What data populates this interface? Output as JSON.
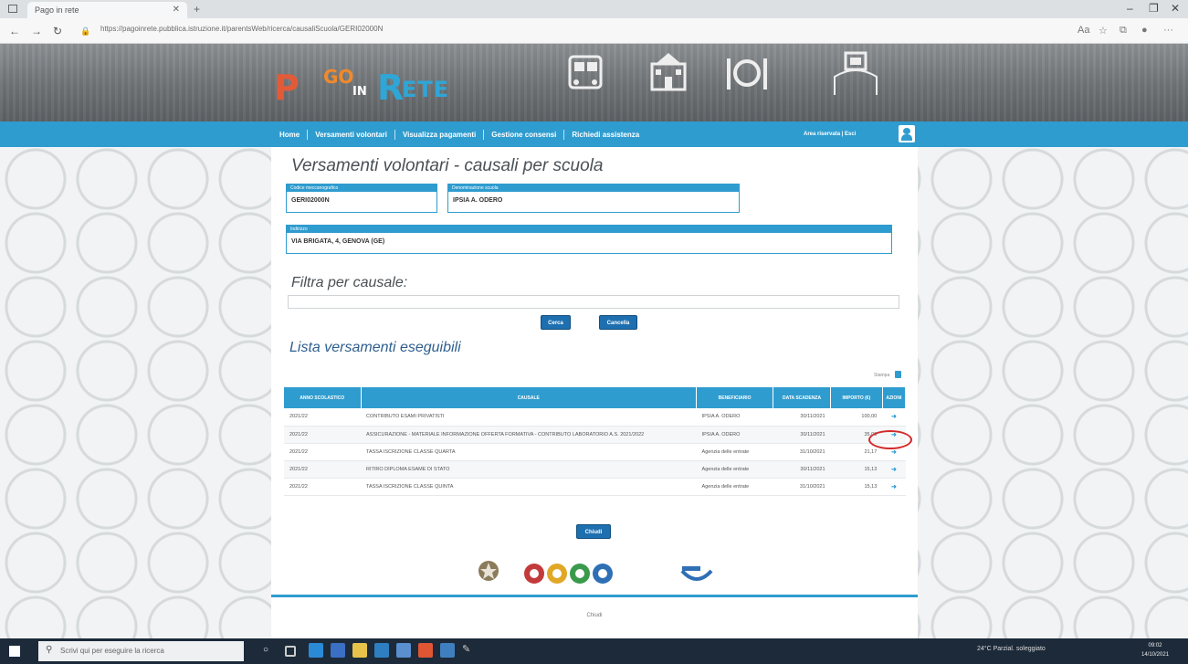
{
  "browser": {
    "tab_title": "Pago in rete",
    "address": "https://pagoinrete.pubblica.istruzione.it/parentsWeb/ricerca/causaliScuola/GERI02000N",
    "window_controls": [
      "–",
      "❐",
      "✕"
    ]
  },
  "nav": {
    "items": [
      "Home",
      "Versamenti volontari",
      "Visualizza pagamenti",
      "Gestione consensi",
      "Richiedi assistenza"
    ],
    "user_label": "Area riservata | Esci"
  },
  "page": {
    "title": "Versamenti volontari - causali per scuola",
    "fields": {
      "codice_label": "Codice meccanografico",
      "codice_value": "GERI02000N",
      "denominazione_label": "Denominazione scuola",
      "denominazione_value": "IPSIA A. ODERO",
      "indirizzo_label": "Indirizzo",
      "indirizzo_value": "VIA BRIGATA, 4, GENOVA (GE)"
    },
    "filter_title": "Filtra per causale:",
    "search_button": "Cerca",
    "cancel_button": "Cancella",
    "list_title": "Lista versamenti eseguibili",
    "print_label": "Stampa",
    "close_button": "Chiudi",
    "footer": "Chiudi"
  },
  "table": {
    "headers": [
      "ANNO SCOLASTICO",
      "CAUSALE",
      "BENEFICIARIO",
      "DATA SCADENZA",
      "IMPORTO (€)",
      "AZIONI"
    ],
    "rows": [
      {
        "anno": "2021/22",
        "causale": "CONTRIBUTO ESAMI PRIVATISTI",
        "beneficiario": "IPSIA A. ODERO",
        "scadenza": "30/11/2021",
        "importo": "100,00"
      },
      {
        "anno": "2021/22",
        "causale": "ASSICURAZIONE - MATERIALE INFORMAZIONE OFFERTA FORMATIVA - CONTRIBUTO LABORATORIO A.S. 2021/2022",
        "beneficiario": "IPSIA A. ODERO",
        "scadenza": "30/11/2021",
        "importo": "35,00"
      },
      {
        "anno": "2021/22",
        "causale": "TASSA ISCRIZIONE CLASSE QUARTA",
        "beneficiario": "Agenzia delle entrate",
        "scadenza": "31/10/2021",
        "importo": "21,17"
      },
      {
        "anno": "2021/22",
        "causale": "RITIRO DIPLOMA ESAME DI STATO",
        "beneficiario": "Agenzia delle entrate",
        "scadenza": "30/11/2021",
        "importo": "15,13"
      },
      {
        "anno": "2021/22",
        "causale": "TASSA ISCRIZIONE CLASSE QUINTA",
        "beneficiario": "Agenzia delle entrate",
        "scadenza": "31/10/2021",
        "importo": "15,13"
      }
    ]
  },
  "taskbar": {
    "search_placeholder": "Scrivi qui per eseguire la ricerca",
    "tray_text": "24°C Parzial. soleggiato",
    "time": "09:02",
    "date": "14/10/2021"
  },
  "colors": {
    "accent": "#2f9ccf",
    "button": "#1d6fb0",
    "highlight": "#d32a2a"
  }
}
